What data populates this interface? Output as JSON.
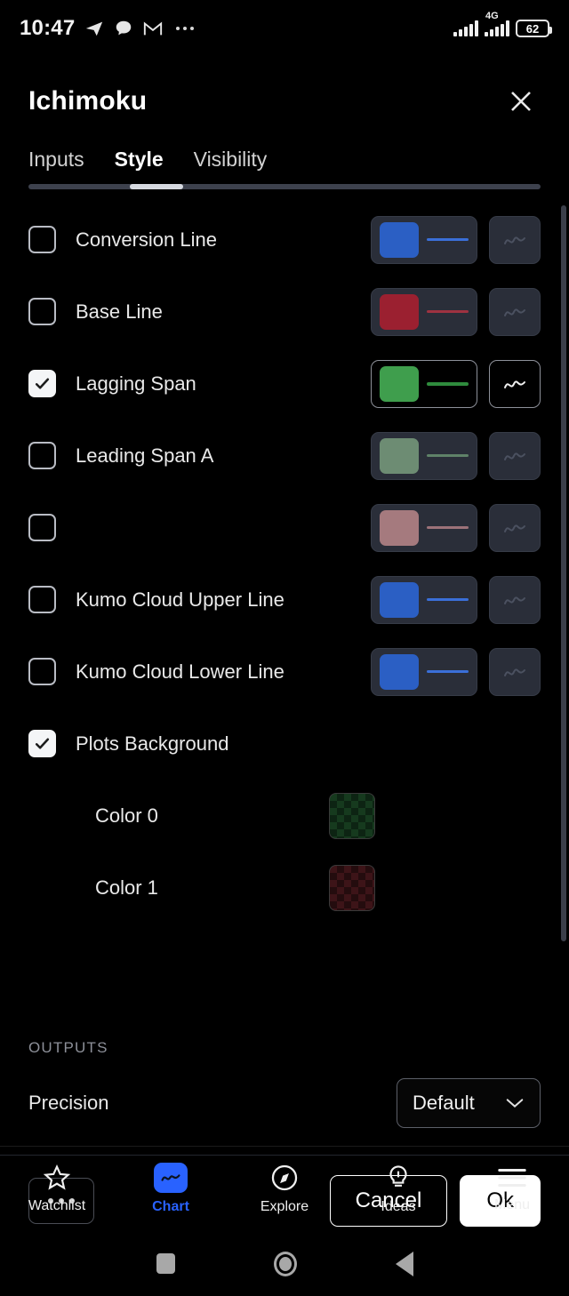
{
  "status_bar": {
    "time": "10:47",
    "left_icons": [
      "telegram-icon",
      "chat-bubble-icon",
      "gmail-icon",
      "overflow-dots-icon"
    ],
    "network_label": "4G",
    "battery_level": "62"
  },
  "dialog": {
    "title": "Ichimoku",
    "close_label": "✕",
    "tabs": [
      {
        "label": "Inputs",
        "active": false
      },
      {
        "label": "Style",
        "active": true
      },
      {
        "label": "Visibility",
        "active": false
      }
    ]
  },
  "style_rows": [
    {
      "label": "Conversion Line",
      "checked": false,
      "color": "#2b5fc4",
      "line_color": "#3a6fd8"
    },
    {
      "label": "Base Line",
      "checked": false,
      "color": "#9b2030",
      "line_color": "#9e3241"
    },
    {
      "label": "Lagging Span",
      "checked": true,
      "color": "#3f9e4d",
      "line_color": "#2f8c3d"
    },
    {
      "label": "Leading Span A",
      "checked": false,
      "color": "#6d8c73",
      "line_color": "#5f8268"
    },
    {
      "label": "",
      "checked": false,
      "color": "#a57a7e",
      "line_color": "#9c7279"
    },
    {
      "label": "Kumo Cloud Upper Line",
      "checked": false,
      "color": "#2b5fc4",
      "line_color": "#3a6fd8"
    },
    {
      "label": "Kumo Cloud Lower Line",
      "checked": false,
      "color": "#2b5fc4",
      "line_color": "#3a6fd8"
    }
  ],
  "plots_background": {
    "label": "Plots Background",
    "checked": true,
    "colors": [
      {
        "label": "Color 0",
        "swatch": "#163a1e"
      },
      {
        "label": "Color 1",
        "swatch": "#3d1418"
      }
    ]
  },
  "outputs": {
    "section_label": "OUTPUTS",
    "precision_label": "Precision",
    "precision_value": "Default"
  },
  "footer": {
    "more_label": "more-options",
    "cancel_label": "Cancel",
    "ok_label": "Ok"
  },
  "bottom_nav": [
    {
      "label": "Watchlist",
      "icon": "star-icon",
      "active": false
    },
    {
      "label": "Chart",
      "icon": "chart-wave-icon",
      "active": true
    },
    {
      "label": "Explore",
      "icon": "compass-icon",
      "active": false
    },
    {
      "label": "Ideas",
      "icon": "lightbulb-icon",
      "active": false
    },
    {
      "label": "Menu",
      "icon": "hamburger-icon",
      "active": false
    }
  ],
  "system_nav": [
    "recents-button",
    "home-button",
    "back-button"
  ],
  "colors": {
    "accent": "#2962ff",
    "panel": "#2a2e39",
    "background": "#000000"
  }
}
